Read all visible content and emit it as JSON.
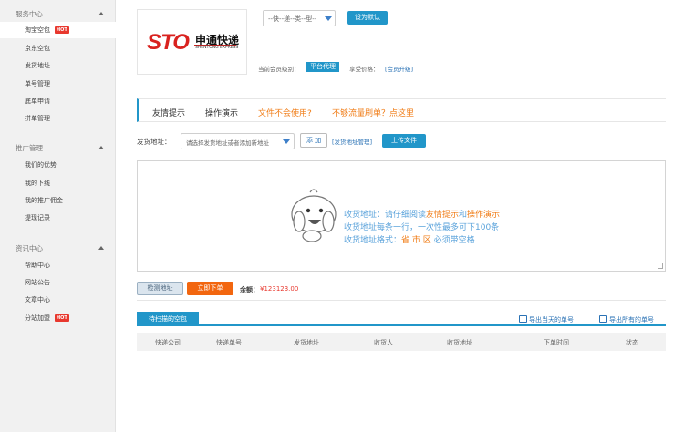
{
  "sidebar": {
    "sections": [
      {
        "title": "服务中心",
        "items": [
          {
            "label": "淘宝空包",
            "hot": "HOT",
            "active": true
          },
          {
            "label": "京东空包"
          },
          {
            "label": "发货地址"
          },
          {
            "label": "单号管理"
          },
          {
            "label": "底单申请"
          },
          {
            "label": "拼单管理"
          }
        ]
      },
      {
        "title": "推广管理",
        "items": [
          {
            "label": "我们的优势"
          },
          {
            "label": "我的下线"
          },
          {
            "label": "我的推广佣金"
          },
          {
            "label": "提现记录"
          }
        ]
      },
      {
        "title": "资讯中心",
        "items": [
          {
            "label": "帮助中心"
          },
          {
            "label": "网站公告"
          },
          {
            "label": "文章中心"
          },
          {
            "label": "分站加盟",
            "hot": "HOT"
          }
        ]
      }
    ]
  },
  "courier": {
    "logo_text": "STO",
    "logo_cn": "申通快递",
    "logo_en": "SHENTONG EXPRESS",
    "type_select": "--快--递--类--型--",
    "set_default": "设为默认",
    "member_level_label": "当前会员级别：",
    "member_level": "平台代理",
    "price_label": "享受价格：",
    "upgrade": "[会员升级]"
  },
  "tabs": {
    "tip": "友情提示",
    "demo": "操作演示",
    "file_help": "文件不会使用?",
    "no_traffic": "不够流量刷单？点这里"
  },
  "address": {
    "label": "发货地址：",
    "select": "请选择发货地址或者添加新地址",
    "add": "添 加",
    "manage": "[发货地址管理]",
    "upload": "上传文件"
  },
  "textarea": {
    "line1_a": "收货地址：请仔细阅读",
    "line1_b": "友情提示",
    "line1_c": "和",
    "line1_d": "操作演示",
    "line2": "收货地址每条一行，一次性最多可下100条",
    "line3_a": "收货地址格式：",
    "line3_b": "省 市 区",
    "line3_c": " 必须带空格"
  },
  "actions": {
    "check": "检测地址",
    "order": "立即下单",
    "balance_label": "余额：",
    "balance_value": "¥123123.00"
  },
  "table": {
    "tab": "待扫描的空包",
    "export_today": "导出当天的单号",
    "export_all": "导出所有的单号",
    "headers": [
      "快递公司",
      "快递单号",
      "发货地址",
      "收货人",
      "收货地址",
      "下单时间",
      "状态"
    ]
  }
}
